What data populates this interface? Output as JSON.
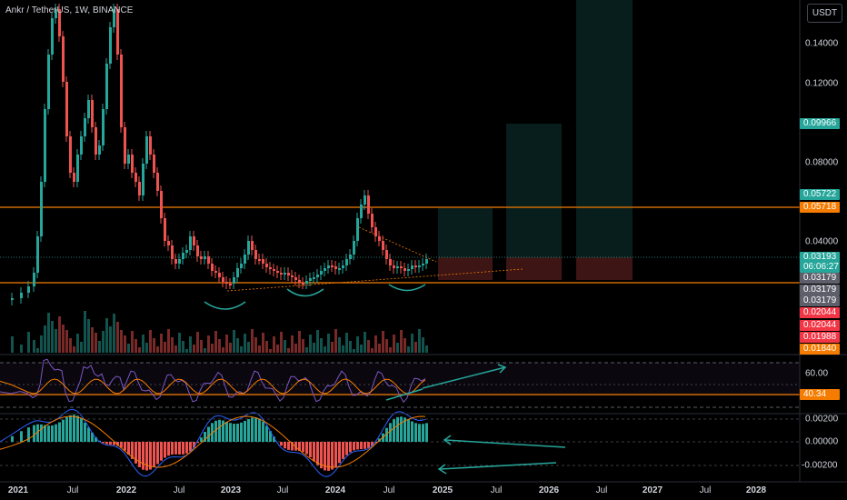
{
  "header": {
    "symbol_line": "Ankr / TetherUS, 1W, BINANCE",
    "currency": "USDT"
  },
  "price_axis": {
    "labels": [
      "0.14000",
      "0.12000",
      "0.08000",
      "0.04000"
    ]
  },
  "price_tags": [
    {
      "text": "0.09966",
      "color": "#26a69a"
    },
    {
      "text": "0.05722",
      "color": "#26a69a"
    },
    {
      "text": "0.05718",
      "color": "#f57c00"
    },
    {
      "text": "0.03193",
      "color": "#26a69a"
    },
    {
      "text": "06:06:27",
      "color": "#26a69a"
    },
    {
      "text": "0.03179",
      "color": "#5d606b"
    },
    {
      "text": "0.03179",
      "color": "#5d606b"
    },
    {
      "text": "0.03179",
      "color": "#5d606b"
    },
    {
      "text": "0.02044",
      "color": "#f23645"
    },
    {
      "text": "0.02044",
      "color": "#f23645"
    },
    {
      "text": "0.01988",
      "color": "#f23645"
    },
    {
      "text": "0.01840",
      "color": "#f57c00"
    }
  ],
  "rsi_axis": {
    "label_60": "60.00",
    "current_value": "40.34",
    "current_color": "#f57c00"
  },
  "macd_axis": {
    "labels": [
      "0.00200",
      "0.00000",
      "-0.00200"
    ]
  },
  "time_axis": {
    "labels": [
      {
        "text": "2021",
        "year": true
      },
      {
        "text": "Jul",
        "year": false
      },
      {
        "text": "2022",
        "year": true
      },
      {
        "text": "Jul",
        "year": false
      },
      {
        "text": "2023",
        "year": true
      },
      {
        "text": "Jul",
        "year": false
      },
      {
        "text": "2024",
        "year": true
      },
      {
        "text": "Jul",
        "year": false
      },
      {
        "text": "2025",
        "year": true
      },
      {
        "text": "Jul",
        "year": false
      },
      {
        "text": "2026",
        "year": true
      },
      {
        "text": "Jul",
        "year": false
      },
      {
        "text": "2027",
        "year": true
      },
      {
        "text": "Jul",
        "year": false
      },
      {
        "text": "2028",
        "year": true
      }
    ]
  },
  "colors": {
    "background": "#000000",
    "up": "#26a69a",
    "down": "#ef5350",
    "level_line": "#f57c00",
    "rsi_line": "#7e57c2",
    "rsi_ma": "#f57c00",
    "annotation": "#26a69a"
  }
}
